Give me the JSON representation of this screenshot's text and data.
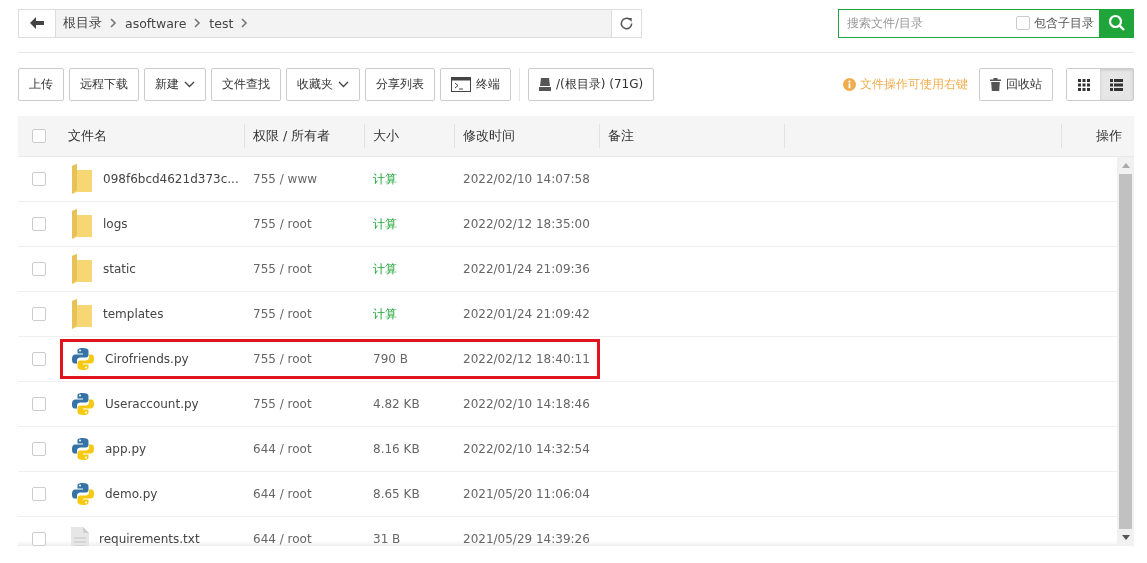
{
  "path_bar": {
    "crumbs": [
      "根目录",
      "asoftware",
      "test"
    ]
  },
  "search": {
    "placeholder": "搜索文件/目录",
    "include_subdirs": {
      "label": "包含子目录",
      "checked": false
    }
  },
  "toolbar": {
    "buttons": [
      {
        "label": "上传",
        "kind": "plain"
      },
      {
        "label": "远程下载",
        "kind": "plain"
      },
      {
        "label": "新建",
        "kind": "dropdown"
      },
      {
        "label": "文件查找",
        "kind": "plain"
      },
      {
        "label": "收藏夹",
        "kind": "dropdown"
      },
      {
        "label": "分享列表",
        "kind": "plain"
      },
      {
        "label": "终端",
        "kind": "terminal"
      }
    ],
    "disk": {
      "label": "/(根目录) (71G)"
    },
    "hint": "文件操作可使用右键",
    "recycle": "回收站",
    "views": [
      {
        "kind": "grid",
        "selected": false
      },
      {
        "kind": "list",
        "selected": true
      }
    ]
  },
  "table": {
    "select_all": {
      "checked": false
    },
    "columns": [
      "文件名",
      "权限 / 所有者",
      "大小",
      "修改时间",
      "备注",
      "操作"
    ],
    "rows": [
      {
        "kind": "folder",
        "name": "098f6bcd4621d373c...",
        "perm": "755 / www",
        "size": "计算",
        "modified": "2022/02/10 14:07:58",
        "checked": false,
        "highlighted": false
      },
      {
        "kind": "folder",
        "name": "logs",
        "perm": "755 / root",
        "size": "计算",
        "modified": "2022/02/12 18:35:00",
        "checked": false,
        "highlighted": false
      },
      {
        "kind": "folder",
        "name": "static",
        "perm": "755 / root",
        "size": "计算",
        "modified": "2022/01/24 21:09:36",
        "checked": false,
        "highlighted": false
      },
      {
        "kind": "folder",
        "name": "templates",
        "perm": "755 / root",
        "size": "计算",
        "modified": "2022/01/24 21:09:42",
        "checked": false,
        "highlighted": false
      },
      {
        "kind": "python",
        "name": "Cirofriends.py",
        "perm": "755 / root",
        "size": "790 B",
        "modified": "2022/02/12 18:40:11",
        "checked": false,
        "highlighted": true
      },
      {
        "kind": "python",
        "name": "Useraccount.py",
        "perm": "755 / root",
        "size": "4.82 KB",
        "modified": "2022/02/10 14:18:46",
        "checked": false,
        "highlighted": false
      },
      {
        "kind": "python",
        "name": "app.py",
        "perm": "644 / root",
        "size": "8.16 KB",
        "modified": "2022/02/10 14:32:54",
        "checked": false,
        "highlighted": false
      },
      {
        "kind": "python",
        "name": "demo.py",
        "perm": "644 / root",
        "size": "8.65 KB",
        "modified": "2021/05/20 11:06:04",
        "checked": false,
        "highlighted": false
      },
      {
        "kind": "text",
        "name": "requirements.txt",
        "perm": "644 / root",
        "size": "31 B",
        "modified": "2021/05/29 14:39:26",
        "checked": false,
        "highlighted": false
      }
    ]
  }
}
